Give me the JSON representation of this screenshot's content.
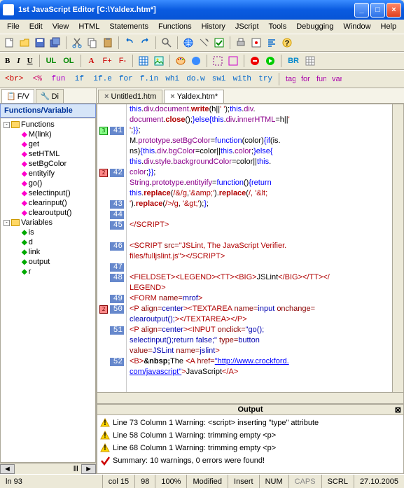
{
  "title": "1st JavaScript Editor      [C:\\Yaldex.htm*]",
  "menu": [
    "File",
    "Edit",
    "View",
    "HTML",
    "Statements",
    "Functions",
    "History",
    "JScript",
    "Tools",
    "Debugging",
    "Window",
    "Help"
  ],
  "toolbar2": {
    "b": "B",
    "i": "I",
    "u": "U",
    "ul": "UL",
    "ol": "OL",
    "fp": "F+",
    "fm": "F-"
  },
  "toolbar3": [
    "<br>",
    "<%",
    "fun",
    "if",
    "if.e",
    "for",
    "f.in",
    "whi",
    "do.w",
    "swi",
    "with",
    "try"
  ],
  "left_tabs": [
    "F/V",
    "Di"
  ],
  "panel_title": "Functions/Variable",
  "tree": {
    "functions": {
      "label": "Functions",
      "items": [
        "M(link)",
        "get",
        "setHTML",
        "setBgColor",
        "entityify",
        "go()",
        "selectinput()",
        "clearinput()",
        "clearoutput()"
      ]
    },
    "variables": {
      "label": "Variables",
      "items": [
        "is",
        "d",
        "link",
        "output",
        "r"
      ]
    }
  },
  "editor_tabs": [
    {
      "label": "Untitled1.htm",
      "active": false
    },
    {
      "label": "Yaldex.htm*",
      "active": true
    }
  ],
  "code_lines": [
    {
      "n": "",
      "html": "<span class='kw'>this</span>.<span class='prop'>div</span>.<span class='prop'>document</span>.<span class='fn'>write</span>(h||<span class='str'>' '</span>);<span class='kw'>this</span>.<span class='prop'>div</span>."
    },
    {
      "n": "",
      "html": "<span class='prop'>document</span>.<span class='fn'>close</span>();<span class='kw'>}else{</span><span class='kw'>this</span>.<span class='prop'>div</span>.<span class='prop'>innerHTML</span>=h||<span class='str'>'</span>"
    },
    {
      "n": "41",
      "marker": "green",
      "html": "<span class='str'>'</span>;<span class='kw'>}}</span>;"
    },
    {
      "n": "",
      "html": "M.<span class='prop'>prototype</span>.<span class='prop'>setBgColor</span>=<span class='kw'>function</span>(color)<span class='kw'>{if</span>(is."
    },
    {
      "n": "",
      "html": "ns)<span class='kw'>{this</span>.<span class='prop'>div</span>.<span class='prop'>bgColor</span>=color||<span class='kw'>this</span>.<span class='prop'>color</span>;<span class='kw'>}else{</span>"
    },
    {
      "n": "",
      "html": "<span class='kw'>this</span>.<span class='prop'>div</span>.<span class='prop'>style</span>.<span class='prop'>backgroundColor</span>=color||<span class='kw'>this</span>."
    },
    {
      "n": "42",
      "marker": "red",
      "html": "<span class='prop'>color</span>;<span class='kw'>}}</span>;"
    },
    {
      "n": "",
      "html": "<span class='prop'>String</span>.<span class='prop'>prototype</span>.<span class='prop'>entityify</span>=<span class='kw'>function</span>()<span class='kw'>{return</span>"
    },
    {
      "n": "",
      "html": "<span class='kw'>this</span>.<span class='fn'>replace</span>(<span class='str'>/&/g</span>,<span class='str'>'&amp;amp;'</span>).<span class='fn'>replace</span>(<span class='str'>/</g</span>, <span class='str'>'&amp;lt;</span>"
    },
    {
      "n": "43",
      "html": "<span class='str'>'</span>).<span class='fn'>replace</span>(<span class='str'>/>/g</span>, <span class='str'>'&amp;gt;'</span>);<span class='kw'>}</span>;"
    },
    {
      "n": "44",
      "html": ""
    },
    {
      "n": "45",
      "html": "<span class='tag'>&lt;/SCRIPT&gt;</span>"
    },
    {
      "n": "",
      "html": ""
    },
    {
      "n": "46",
      "html": "<span class='tag'>&lt;SCRIPT</span> <span class='attr'>src=</span><span class='str'>\"JSLint, The JavaScript Verifier.</span>"
    },
    {
      "n": "",
      "html": "<span class='str'>files/fulljslint.js\"</span><span class='tag'>&gt;&lt;/SCRIPT&gt;</span>"
    },
    {
      "n": "47",
      "html": ""
    },
    {
      "n": "48",
      "html": "<span class='tag'>&lt;FIELDSET&gt;&lt;LEGEND&gt;&lt;TT&gt;&lt;BIG&gt;</span>JSLint<span class='tag'>&lt;/BIG&gt;&lt;/TT&gt;&lt;/</span>"
    },
    {
      "n": "",
      "html": "<span class='tag'>LEGEND&gt;</span>"
    },
    {
      "n": "49",
      "html": "<span class='tag'>&lt;FORM</span> <span class='attr'>name=</span><span class='val'>mrof</span><span class='tag'>&gt;</span>"
    },
    {
      "n": "50",
      "marker": "red",
      "html": "<span class='tag'>&lt;P</span> <span class='attr'>align=</span><span class='val'>center</span><span class='tag'>&gt;&lt;TEXTAREA</span> <span class='attr'>name=</span><span class='val'>input</span> <span class='attr'>onchange=</span>"
    },
    {
      "n": "",
      "html": "<span class='val'>clearoutput();</span><span class='tag'>&gt;&lt;/TEXTAREA&gt;&lt;/P&gt;</span>"
    },
    {
      "n": "51",
      "html": "<span class='tag'>&lt;P</span> <span class='attr'>align=</span><span class='val'>center</span><span class='tag'>&gt;&lt;INPUT</span> <span class='attr'>onclick=</span><span class='val'>\"go();</span>"
    },
    {
      "n": "",
      "html": "<span class='val'>selectinput();return false;\"</span> <span class='attr'>type=</span><span class='val'>button</span>"
    },
    {
      "n": "",
      "html": "<span class='attr'>value=</span><span class='val'>JSLint</span> <span class='attr'>name=</span><span class='val'>jslint</span><span class='tag'>&gt;</span>"
    },
    {
      "n": "52",
      "html": "<span class='tag'>&lt;B&gt;</span><b>&amp;nbsp;</b>The <span class='tag'>&lt;A</span> <span class='attr'>href=</span><span class='url'>\"http://www.crockford.</span>"
    },
    {
      "n": "",
      "html": "<span class='url'>com/javascript\"</span><span class='tag'>&gt;</span>JavaScript<span class='tag'>&lt;/A&gt;</span>"
    }
  ],
  "output": {
    "title": "Output",
    "lines": [
      {
        "type": "warn",
        "text": "Line 73 Column 1  Warning: <script> inserting \"type\" attribute"
      },
      {
        "type": "warn",
        "text": "Line 58 Column 1  Warning: trimming empty <p>"
      },
      {
        "type": "warn",
        "text": "Line 68 Column 1  Warning: trimming empty <p>"
      },
      {
        "type": "ok",
        "text": "Summary: 10 warnings, 0 errors were found!"
      }
    ]
  },
  "status": {
    "ln": "ln 93",
    "col": "col 15",
    "p1": "98",
    "p2": "100%",
    "mod": "Modified",
    "ins": "Insert",
    "num": "NUM",
    "scrl": "SCRL",
    "date": "27.10.2005"
  }
}
